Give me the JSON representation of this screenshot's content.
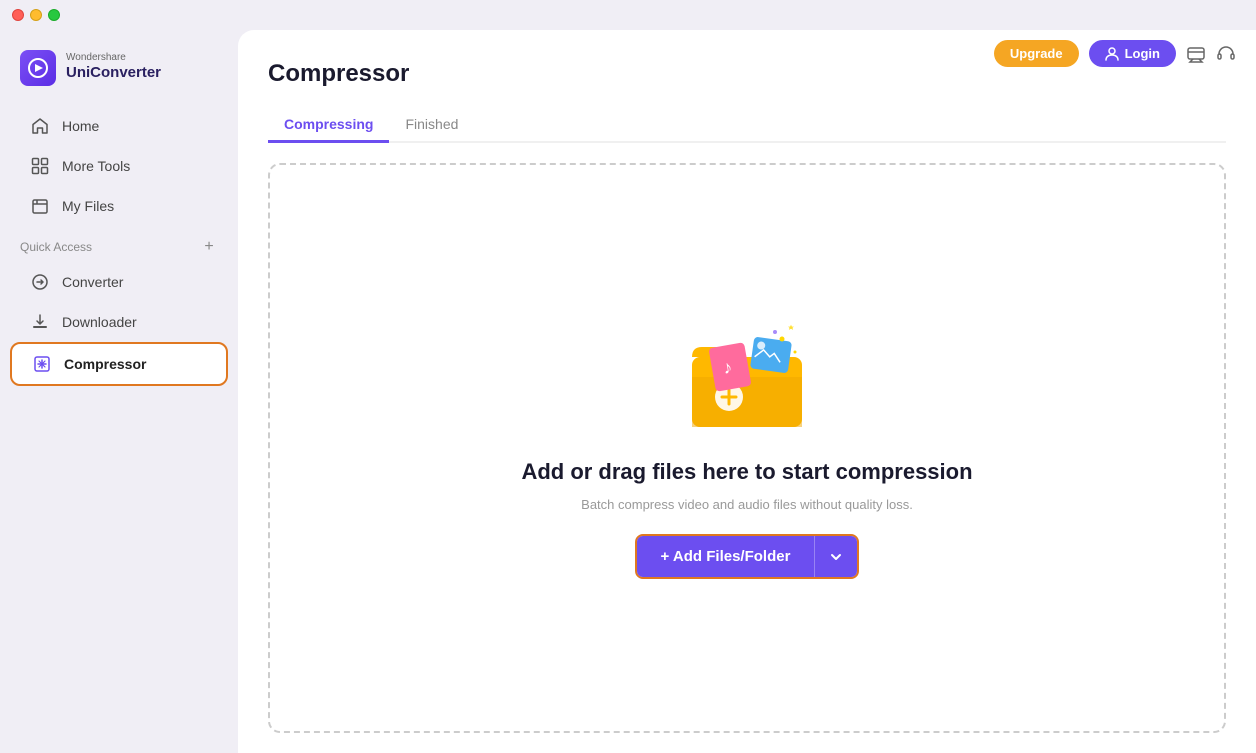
{
  "titlebar": {
    "traffic_close": "close",
    "traffic_minimize": "minimize",
    "traffic_maximize": "maximize"
  },
  "logo": {
    "brand": "Wondershare",
    "product": "UniConverter"
  },
  "nav": {
    "items": [
      {
        "id": "home",
        "label": "Home",
        "icon": "home-icon"
      },
      {
        "id": "more-tools",
        "label": "More Tools",
        "icon": "tools-icon"
      },
      {
        "id": "my-files",
        "label": "My Files",
        "icon": "files-icon"
      }
    ]
  },
  "quick_access": {
    "label": "Quick Access",
    "add_label": "+",
    "items": [
      {
        "id": "converter",
        "label": "Converter",
        "icon": "converter-icon"
      },
      {
        "id": "downloader",
        "label": "Downloader",
        "icon": "downloader-icon"
      },
      {
        "id": "compressor",
        "label": "Compressor",
        "icon": "compressor-icon",
        "active": true
      }
    ]
  },
  "header": {
    "upgrade_label": "Upgrade",
    "login_label": "Login",
    "support_icon": "support-icon",
    "headphones_icon": "headphones-icon"
  },
  "page": {
    "title": "Compressor",
    "tabs": [
      {
        "id": "compressing",
        "label": "Compressing",
        "active": true
      },
      {
        "id": "finished",
        "label": "Finished",
        "active": false
      }
    ]
  },
  "dropzone": {
    "main_text": "Add or drag files here to start compression",
    "sub_text": "Batch compress video and audio files without quality loss.",
    "add_button_label": "+ Add Files/Folder",
    "dropdown_icon": "chevron-down-icon"
  }
}
